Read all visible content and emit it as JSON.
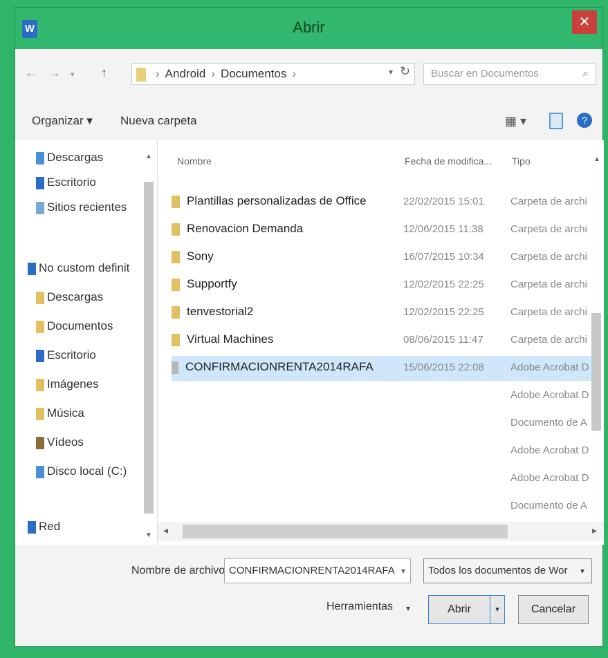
{
  "window": {
    "title": "Abrir"
  },
  "address": {
    "segments": [
      "Android",
      "Documentos"
    ]
  },
  "search": {
    "placeholder": "Buscar en Documentos"
  },
  "toolbar": {
    "organize": "Organizar ▾",
    "new_folder": "Nueva carpeta"
  },
  "sidebar": {
    "items": [
      {
        "label": "Descargas",
        "icon": "download-icon",
        "color": "#4a8fd6"
      },
      {
        "label": "Escritorio",
        "icon": "desktop-icon",
        "color": "#2b6cc4"
      },
      {
        "label": "Sitios recientes",
        "icon": "recent-icon",
        "color": "#7aa7d8"
      },
      {
        "label": "No custom definit",
        "icon": "computer-icon",
        "color": "#2b6cc4"
      },
      {
        "label": "Descargas",
        "icon": "download-icon",
        "color": "#e2c062"
      },
      {
        "label": "Documentos",
        "icon": "documents-icon",
        "color": "#e2c062"
      },
      {
        "label": "Escritorio",
        "icon": "desktop-icon",
        "color": "#2b6cc4"
      },
      {
        "label": "Imágenes",
        "icon": "pictures-icon",
        "color": "#e2c062"
      },
      {
        "label": "Música",
        "icon": "music-icon",
        "color": "#e2c062"
      },
      {
        "label": "Vídeos",
        "icon": "videos-icon",
        "color": "#8a6d3b"
      },
      {
        "label": "Disco local (C:)",
        "icon": "drive-icon",
        "color": "#4a8fd6"
      },
      {
        "label": "Red",
        "icon": "network-icon",
        "color": "#2b6cc4"
      }
    ]
  },
  "columns": {
    "name": "Nombre",
    "date": "Fecha de modifica...",
    "type": "Tipo"
  },
  "files": [
    {
      "name": "Plantillas personalizadas de Office",
      "date": "22/02/2015 15:01",
      "type": "Carpeta de archi",
      "kind": "folder"
    },
    {
      "name": "Renovacion Demanda",
      "date": "12/06/2015 11:38",
      "type": "Carpeta de archi",
      "kind": "folder"
    },
    {
      "name": "Sony",
      "date": "16/07/2015 10:34",
      "type": "Carpeta de archi",
      "kind": "folder"
    },
    {
      "name": "Supportfy",
      "date": "12/02/2015 22:25",
      "type": "Carpeta de archi",
      "kind": "folder"
    },
    {
      "name": "tenvestorial2",
      "date": "12/02/2015 22:25",
      "type": "Carpeta de archi",
      "kind": "folder"
    },
    {
      "name": "Virtual Machines",
      "date": "08/06/2015 11:47",
      "type": "Carpeta de archi",
      "kind": "folder"
    },
    {
      "name": "CONFIRMACIONRENTA2014RAFA",
      "date": "15/06/2015 22:08",
      "type": "Adobe Acrobat D",
      "kind": "pdf"
    },
    {
      "name": "",
      "date": "",
      "type": "Adobe Acrobat D",
      "kind": "none"
    },
    {
      "name": "",
      "date": "",
      "type": "Documento de A",
      "kind": "none"
    },
    {
      "name": "",
      "date": "",
      "type": "Adobe Acrobat D",
      "kind": "none"
    },
    {
      "name": "",
      "date": "",
      "type": "Adobe Acrobat D",
      "kind": "none"
    },
    {
      "name": "",
      "date": "",
      "type": "Documento de A",
      "kind": "none"
    }
  ],
  "footer": {
    "filename_label": "Nombre de archivo:",
    "filename_value": "CONFIRMACIONRENTA2014RAFA",
    "filter_value": "Todos los documentos de Wor",
    "tools_label": "Herramientas",
    "open_label": "Abrir",
    "cancel_label": "Cancelar"
  }
}
